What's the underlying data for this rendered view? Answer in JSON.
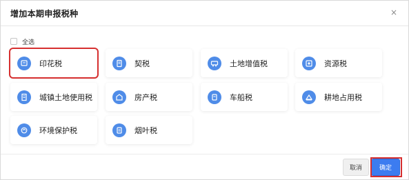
{
  "dialog": {
    "title": "增加本期申报税种",
    "close": "×",
    "select_all_label": "全选"
  },
  "taxes": [
    {
      "label": "印花税",
      "icon": "stamp-icon",
      "highlighted": true
    },
    {
      "label": "契税",
      "icon": "contract-icon",
      "highlighted": false
    },
    {
      "label": "土地增值税",
      "icon": "land-vat-icon",
      "highlighted": false
    },
    {
      "label": "资源税",
      "icon": "resource-icon",
      "highlighted": false
    },
    {
      "label": "城镇土地使用税",
      "icon": "urban-land-icon",
      "highlighted": false
    },
    {
      "label": "房产税",
      "icon": "property-icon",
      "highlighted": false
    },
    {
      "label": "车船税",
      "icon": "vehicle-icon",
      "highlighted": false
    },
    {
      "label": "耕地占用税",
      "icon": "farmland-icon",
      "highlighted": false
    },
    {
      "label": "环境保护税",
      "icon": "environment-icon",
      "highlighted": false
    },
    {
      "label": "烟叶税",
      "icon": "tobacco-icon",
      "highlighted": false
    }
  ],
  "footer": {
    "cancel_label": "取消",
    "ok_label": "确定"
  },
  "colors": {
    "accent": "#3c7cf0",
    "icon_bg": "#4f8ce8",
    "highlight": "#d62f2f"
  }
}
